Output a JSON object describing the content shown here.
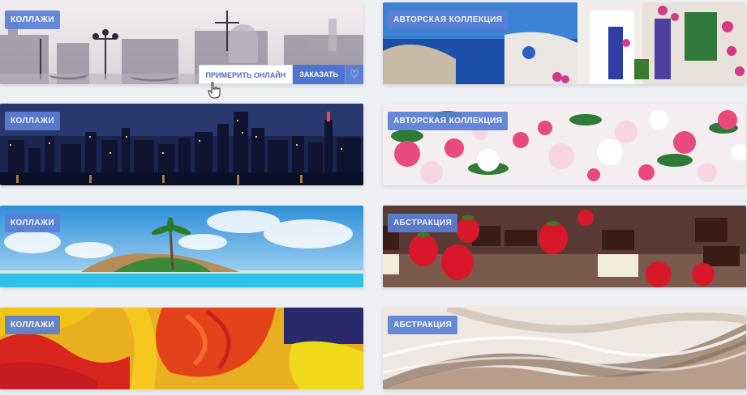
{
  "cards": [
    {
      "badge": "КОЛЛАЖИ"
    },
    {
      "badge": "АВТОРСКАЯ КОЛЛЕКЦИЯ"
    },
    {
      "badge": "КОЛЛАЖИ"
    },
    {
      "badge": "АВТОРСКАЯ КОЛЛЕКЦИЯ"
    },
    {
      "badge": "КОЛЛАЖИ"
    },
    {
      "badge": "АБСТРАКЦИЯ"
    },
    {
      "badge": "КОЛЛАЖИ"
    },
    {
      "badge": "АБСТРАКЦИЯ"
    }
  ],
  "hover_actions": {
    "try_online": "ПРИМЕРИТЬ ОНЛАЙН",
    "order": "ЗАКАЗАТЬ",
    "favorite_icon": "heart-icon"
  },
  "colors": {
    "badge_bg": "#5a7fd6",
    "order_btn": "#4f74cf",
    "page_bg": "#eef0f4"
  }
}
